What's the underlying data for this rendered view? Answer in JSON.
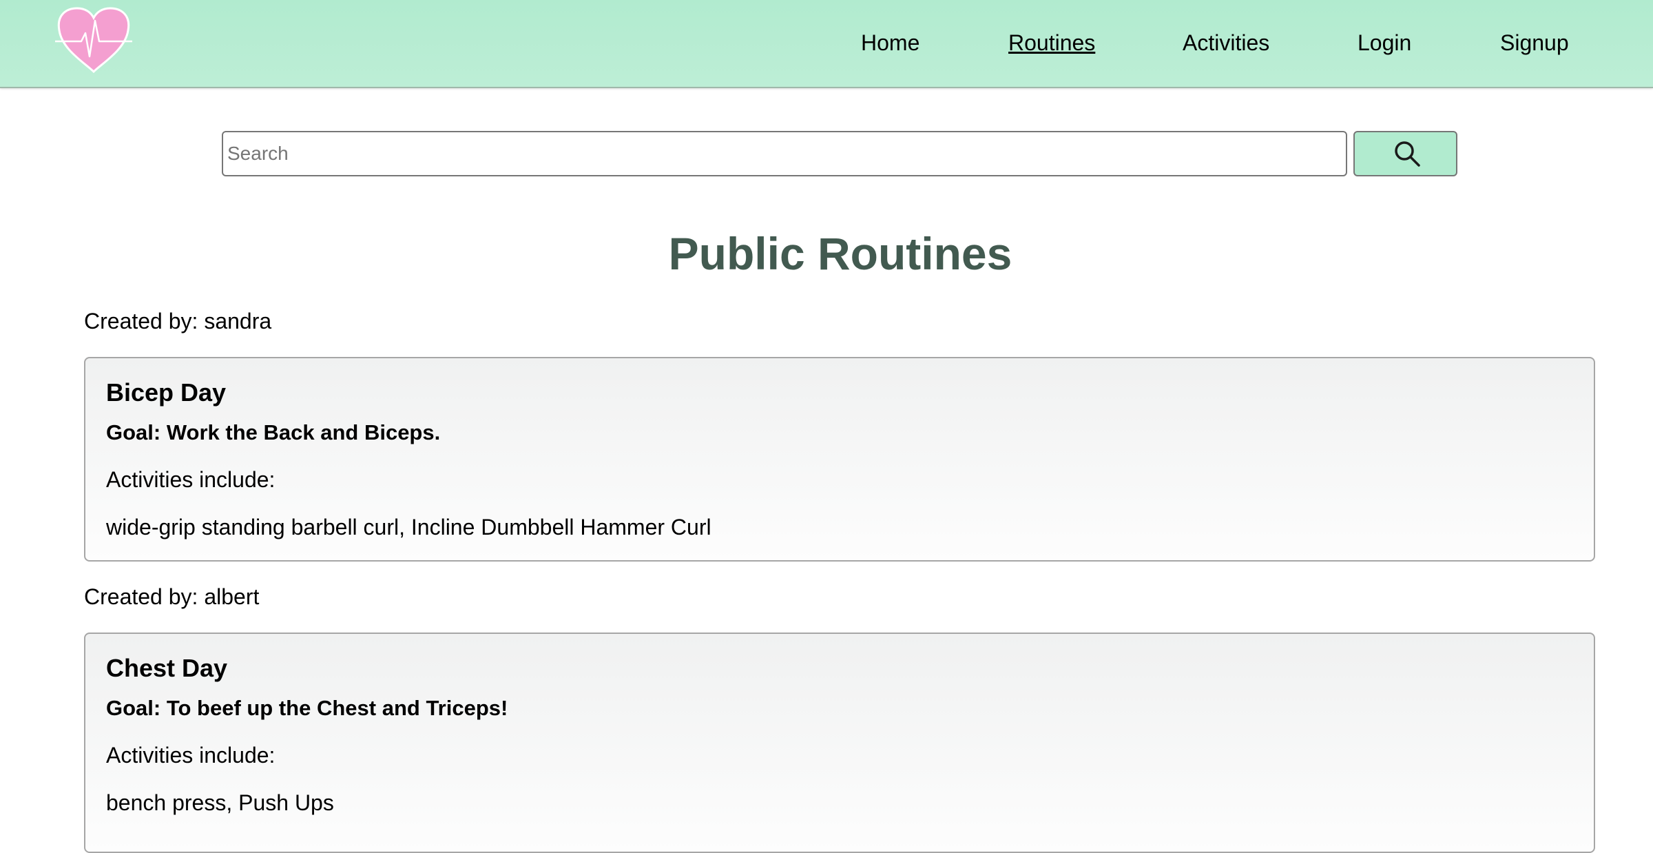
{
  "header": {
    "logo_icon": "heart-pulse-icon",
    "nav": [
      {
        "label": "Home",
        "active": false
      },
      {
        "label": "Routines",
        "active": true
      },
      {
        "label": "Activities",
        "active": false
      },
      {
        "label": "Login",
        "active": false
      },
      {
        "label": "Signup",
        "active": false
      }
    ]
  },
  "search": {
    "placeholder": "Search",
    "value": "",
    "button_icon": "search-icon"
  },
  "page_title": "Public Routines",
  "routines": [
    {
      "created_by": "Created by: sandra",
      "name": "Bicep Day",
      "goal": "Goal: Work the Back and Biceps.",
      "activities_label": "Activities include:",
      "activities": "wide-grip standing barbell curl, Incline Dumbbell Hammer Curl"
    },
    {
      "created_by": "Created by: albert",
      "name": "Chest Day",
      "goal": "Goal: To beef up the Chest and Triceps!",
      "activities_label": "Activities include:",
      "activities": "bench press, Push Ups"
    }
  ],
  "colors": {
    "header_background": "#b1ebcf",
    "title": "#425a50",
    "logo_heart": "#f49fd0"
  }
}
